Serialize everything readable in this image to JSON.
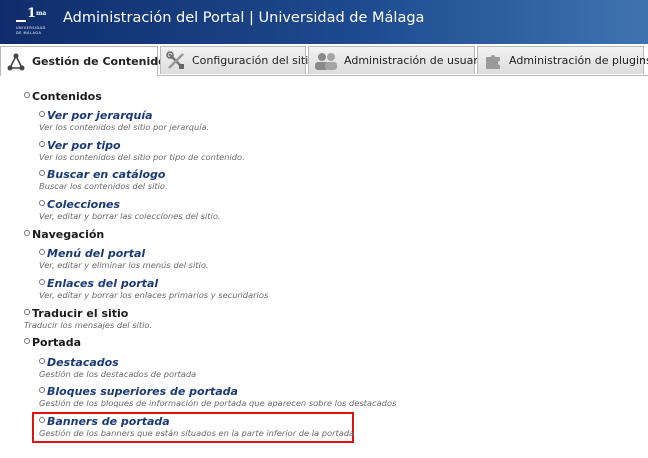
{
  "header": {
    "title": "Administración del Portal | Universidad de Málaga",
    "logo": {
      "mark": "1",
      "mark_sup": "ma",
      "line1": "UNIVERSIDAD",
      "line2": "DE MÁLAGA"
    }
  },
  "tabs": [
    {
      "label": "Gestión de Contenido",
      "icon": "network-icon",
      "active": true
    },
    {
      "label": "Configuración del sitio",
      "icon": "tools-icon",
      "active": false
    },
    {
      "label": "Administración de usuario",
      "icon": "users-icon",
      "active": false
    },
    {
      "label": "Administración de plugins",
      "icon": "puzzle-icon",
      "active": false
    }
  ],
  "menu": {
    "contenidos": {
      "title": "Contenidos",
      "items": [
        {
          "label": "Ver por jerarquía",
          "desc": "Ver los contenidos del sitio por jerarquía."
        },
        {
          "label": "Ver por tipo",
          "desc": "Ver los contenidos del sitio por tipo de contenido."
        },
        {
          "label": "Buscar en catálogo",
          "desc": "Buscar los contenidos del sitio."
        },
        {
          "label": "Colecciones",
          "desc": "Ver, editar y borrar las colecciones del sitio."
        }
      ]
    },
    "navegacion": {
      "title": "Navegación",
      "items": [
        {
          "label": "Menú del portal",
          "desc": "Ver, editar y eliminar los menús del sitio."
        },
        {
          "label": "Enlaces del portal",
          "desc": "Ver, editar y borrar los enlaces primarios y secundarios"
        }
      ]
    },
    "traducir": {
      "title": "Traducir el sitio",
      "desc": "Traducir los mensajes del sitio."
    },
    "portada": {
      "title": "Portada",
      "items": [
        {
          "label": "Destacados",
          "desc": "Gestión de los destacados de portada"
        },
        {
          "label": "Bloques superiores de portada",
          "desc": "Gestión de los bloques de información de portada que aparecen sobre los destacados"
        },
        {
          "label": "Banners de portada",
          "desc": "Gestión de los banners que están situados en la parte inferior de la portada"
        }
      ]
    }
  },
  "colors": {
    "header_start": "#0f2d6b",
    "header_end": "#3f73b0",
    "link": "#1a3a75",
    "highlight": "#e01010"
  }
}
